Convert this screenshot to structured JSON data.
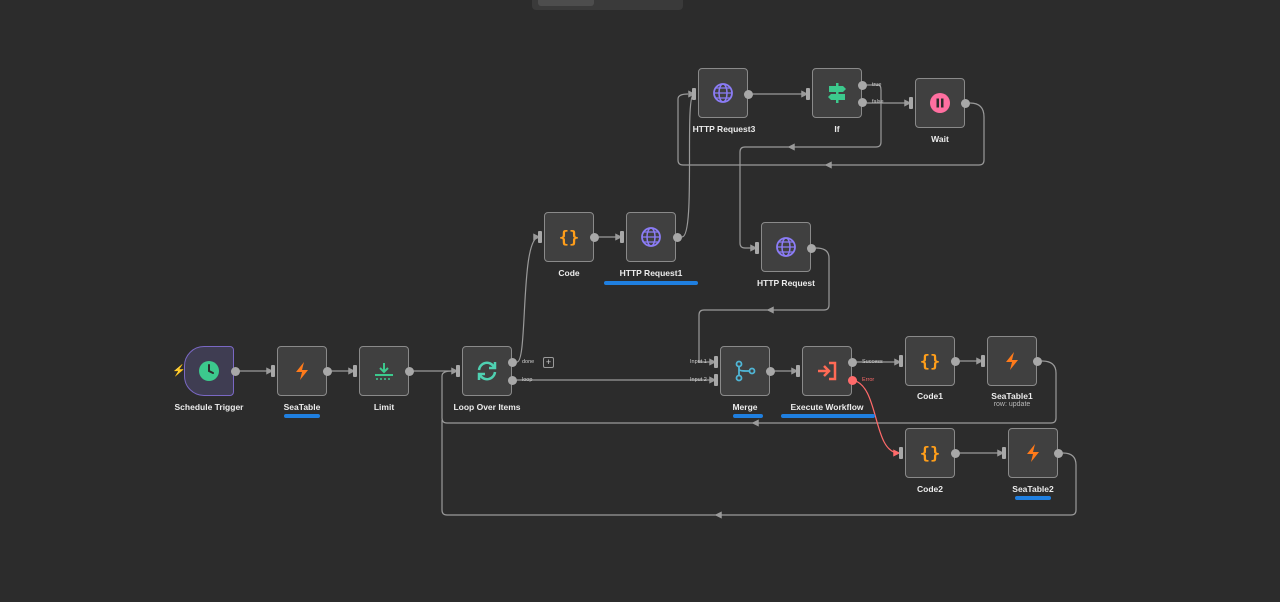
{
  "colors": {
    "canvas": "#2c2c2c",
    "node_bg": "#404040",
    "edge": "#9a9a9a",
    "error_edge": "#ff6a6a",
    "scribble": "#1f7fe0",
    "seatable_icon": "#ff7a1a",
    "code_icon": "#ff9e1a",
    "http_icon": "#8b7cf6",
    "schedule_icon": "#3cc98d",
    "if_icon": "#3cc98d",
    "wait_icon": "#ff6fa0",
    "limit_icon": "#3cc98d",
    "loop_icon": "#4fd1b2",
    "merge_icon": "#4fb6d6",
    "execute_icon": "#ff6a55"
  },
  "nodes": {
    "schedule_trigger": {
      "label": "Schedule Trigger",
      "icon": "clock-icon"
    },
    "seatable": {
      "label": "SeaTable",
      "icon": "seatable-icon"
    },
    "limit": {
      "label": "Limit",
      "icon": "limit-icon"
    },
    "loop": {
      "label": "Loop Over Items",
      "icon": "loop-icon",
      "out_done": "done",
      "out_loop": "loop"
    },
    "code": {
      "label": "Code",
      "icon": "code-icon"
    },
    "http_request1": {
      "label": "HTTP Request1",
      "icon": "globe-icon"
    },
    "http_request3": {
      "label": "HTTP Request3",
      "icon": "globe-icon"
    },
    "if": {
      "label": "If",
      "icon": "signpost-icon",
      "out_true": "true",
      "out_false": "false"
    },
    "wait": {
      "label": "Wait",
      "icon": "pause-icon"
    },
    "http_request": {
      "label": "HTTP Request",
      "icon": "globe-icon"
    },
    "merge": {
      "label": "Merge",
      "icon": "merge-icon",
      "in_1": "Input 1",
      "in_2": "Input 2"
    },
    "execute_workflow": {
      "label": "Execute Workflow",
      "icon": "sign-in-icon",
      "out_success": "Success",
      "out_error": "Error"
    },
    "code1": {
      "label": "Code1",
      "icon": "code-icon"
    },
    "seatable1": {
      "label": "SeaTable1",
      "subtitle": "row: update",
      "icon": "seatable-icon"
    },
    "code2": {
      "label": "Code2",
      "icon": "code-icon"
    },
    "seatable2": {
      "label": "SeaTable2",
      "icon": "seatable-icon"
    }
  }
}
